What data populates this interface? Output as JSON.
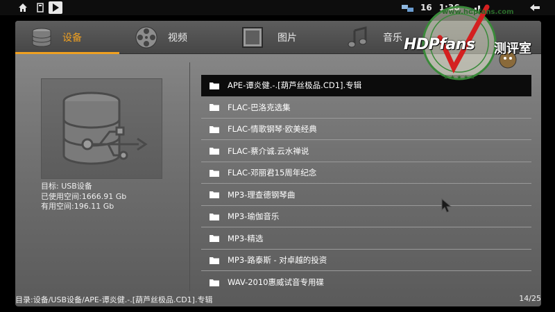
{
  "status_bar": {
    "icons": [
      "home-icon",
      "sd-card-icon",
      "play-store-icon",
      "usb-debug-icon",
      "signal-icon",
      "back-icon"
    ],
    "signal_text": "16",
    "time": "1:36"
  },
  "tabs": [
    {
      "label": "设备",
      "icon": "database-icon",
      "active": true
    },
    {
      "label": "视频",
      "icon": "film-reel-icon",
      "active": false
    },
    {
      "label": "图片",
      "icon": "picture-frame-icon",
      "active": false
    },
    {
      "label": "音乐",
      "icon": "music-note-icon",
      "active": false
    }
  ],
  "device_info": {
    "target": "目标: USB设备",
    "used": "已使用空间:1666.91 Gb",
    "free": "有用空间:196.11 Gb"
  },
  "files": [
    {
      "name": "APE-谭炎健.-.[葫芦丝极品.CD1].专辑",
      "selected": true
    },
    {
      "name": "FLAC-巴洛克选集",
      "selected": false
    },
    {
      "name": "FLAC-情歌钢琴·欧美经典",
      "selected": false
    },
    {
      "name": "FLAC-蔡介诚.云水禅说",
      "selected": false
    },
    {
      "name": "FLAC-邓丽君15周年纪念",
      "selected": false
    },
    {
      "name": "MP3-理查德钢琴曲",
      "selected": false
    },
    {
      "name": "MP3-瑜伽音乐",
      "selected": false
    },
    {
      "name": "MP3-精选",
      "selected": false
    },
    {
      "name": "MP3-路泰斯 - 对卓越的投资",
      "selected": false
    },
    {
      "name": "WAV-2010惠威试音专用碟",
      "selected": false
    }
  ],
  "footer": {
    "path": "目录:设备/USB设备/APE-谭炎健.-.[葫芦丝极品.CD1].专辑",
    "count": "14/25"
  },
  "watermark": {
    "url": "www.hdpfans.com",
    "brand": "HDPfans",
    "brand_cn": "测评室"
  },
  "colors": {
    "accent": "#f0a020",
    "selected_row": "#0c0c0c"
  }
}
